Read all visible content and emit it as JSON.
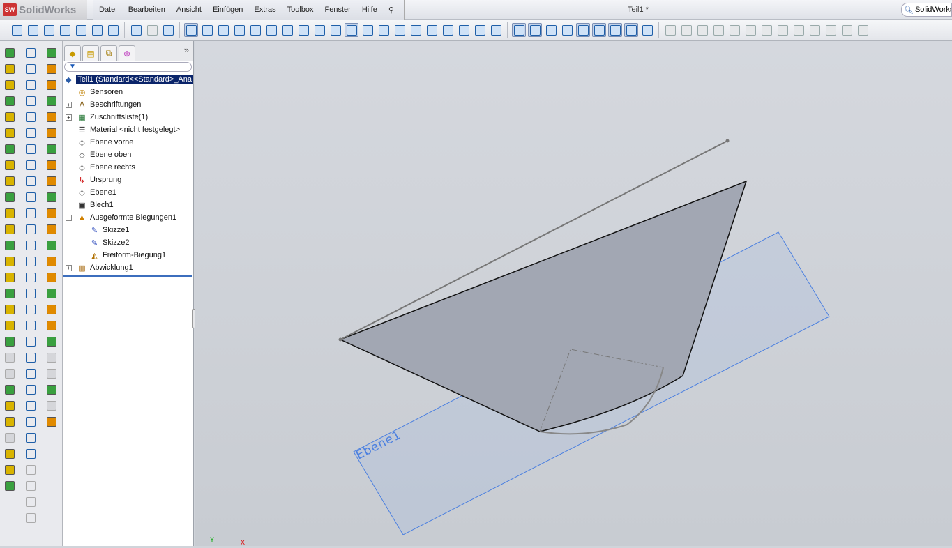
{
  "app": {
    "logo_text": "SolidWorks",
    "logo_badge": "SW",
    "document_title": "Teil1 *",
    "search_label": "SolidWorks"
  },
  "menu": [
    "Datei",
    "Bearbeiten",
    "Ansicht",
    "Einfügen",
    "Extras",
    "Toolbox",
    "Fenster",
    "Hilfe"
  ],
  "tree": {
    "filter_icon": "funnel-icon",
    "expand_label": "»",
    "root": "Teil1  (Standard<<Standard>_Ana",
    "items": [
      {
        "label": "Sensoren",
        "icon": "sensor-icon",
        "level": 1,
        "toggle": ""
      },
      {
        "label": "Beschriftungen",
        "icon": "annotations-icon",
        "level": 1,
        "toggle": "+"
      },
      {
        "label": "Zuschnittsliste(1)",
        "icon": "cutlist-icon",
        "level": 1,
        "toggle": "+"
      },
      {
        "label": "Material <nicht festgelegt>",
        "icon": "material-icon",
        "level": 1,
        "toggle": ""
      },
      {
        "label": "Ebene vorne",
        "icon": "plane-icon",
        "level": 1,
        "toggle": ""
      },
      {
        "label": "Ebene oben",
        "icon": "plane-icon",
        "level": 1,
        "toggle": ""
      },
      {
        "label": "Ebene rechts",
        "icon": "plane-icon",
        "level": 1,
        "toggle": ""
      },
      {
        "label": "Ursprung",
        "icon": "origin-icon",
        "level": 1,
        "toggle": ""
      },
      {
        "label": "Ebene1",
        "icon": "plane-icon",
        "level": 1,
        "toggle": ""
      },
      {
        "label": "Blech1",
        "icon": "sheetmetal-icon",
        "level": 1,
        "toggle": ""
      },
      {
        "label": "Ausgeformte Biegungen1",
        "icon": "lofted-bend-icon",
        "level": 1,
        "toggle": "−"
      },
      {
        "label": "Skizze1",
        "icon": "sketch-icon",
        "level": 2,
        "toggle": ""
      },
      {
        "label": "Skizze2",
        "icon": "sketch-icon",
        "level": 2,
        "toggle": ""
      },
      {
        "label": "Freiform-Biegung1",
        "icon": "flat-bend-icon",
        "level": 2,
        "toggle": ""
      },
      {
        "label": "Abwicklung1",
        "icon": "flatten-icon",
        "level": 1,
        "toggle": "+"
      }
    ]
  },
  "viewport": {
    "plane_label": "Ebene1",
    "triad_x": "X",
    "triad_y": "Y"
  },
  "colors": {
    "selection": "#0a246a",
    "plane": "#4a7fe0",
    "face": "#a2a7b3"
  }
}
